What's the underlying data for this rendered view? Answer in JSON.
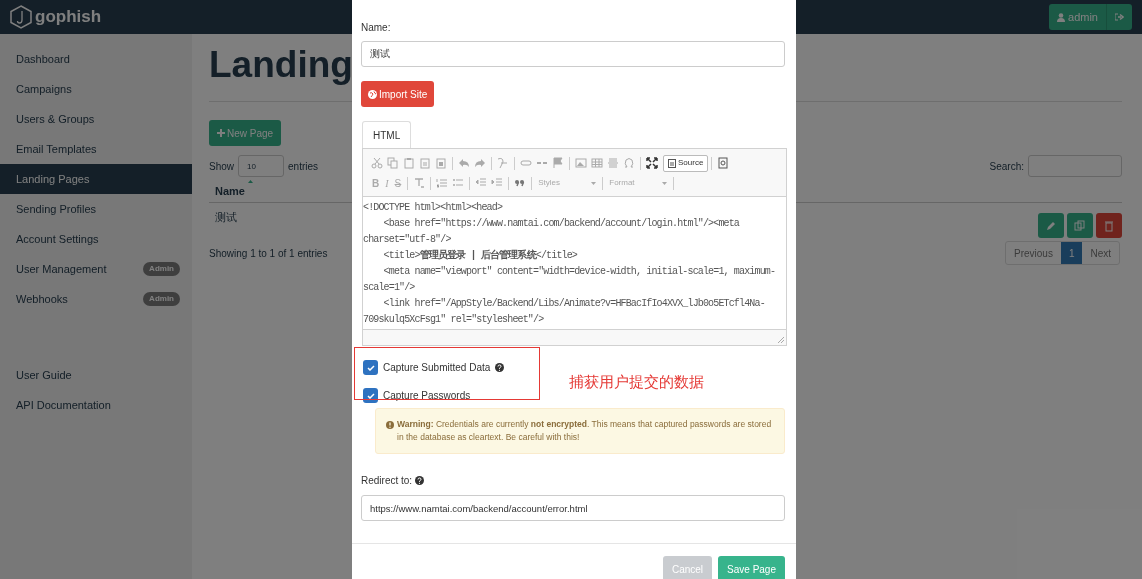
{
  "navbar": {
    "brand": "gophish",
    "user": "admin"
  },
  "sidebar": {
    "items": [
      {
        "label": "Dashboard",
        "selected": false
      },
      {
        "label": "Campaigns",
        "selected": false
      },
      {
        "label": "Users & Groups",
        "selected": false
      },
      {
        "label": "Email Templates",
        "selected": false
      },
      {
        "label": "Landing Pages",
        "selected": true
      },
      {
        "label": "Sending Profiles",
        "selected": false
      },
      {
        "label": "Account Settings",
        "selected": false
      },
      {
        "label": "User Management",
        "selected": false,
        "badge": "Admin"
      },
      {
        "label": "Webhooks",
        "selected": false,
        "badge": "Admin"
      }
    ],
    "links": [
      "User Guide",
      "API Documentation"
    ]
  },
  "page": {
    "title": "Landing",
    "new_button": "New Page",
    "length_before": "Show",
    "length_value": "10",
    "length_after": "entries",
    "search_label": "Search:",
    "columns": [
      "Name"
    ],
    "rows": [
      {
        "name": "测试"
      }
    ],
    "info": "Showing 1 to 1 of 1 entries",
    "pagination": [
      {
        "label": "Previous",
        "selected": false
      },
      {
        "label": "1",
        "selected": true
      },
      {
        "label": "Next",
        "selected": false
      }
    ]
  },
  "modal": {
    "name_label": "Name:",
    "name_value": "测试",
    "import_button": "Import Site",
    "tabs": [
      {
        "label": "HTML",
        "selected": true
      }
    ],
    "toolbar": {
      "source_button": "Source",
      "format_letters": [
        "B",
        "I",
        "S"
      ],
      "dropdowns": [
        "Styles",
        "Format"
      ]
    },
    "code_lines": [
      "<!DOCTYPE html><html><head>",
      "    <base href=\"https://www.namtai.com/backend/account/login.html\"/><meta",
      "charset=\"utf-8\"/>",
      "    <title>**管理员登录 | 后台管理系统**</title>",
      "    <meta name=\"viewport\" content=\"width=device-width, initial-scale=1, maximum-",
      "scale=1\"/>",
      "    <link href=\"/AppStyle/Backend/Libs/Animate?v=HFBacIfIo4XVX_lJb0o5ETcfl4Na-",
      "709skulq5XcFsg1\" rel=\"stylesheet\"/>"
    ],
    "options": [
      {
        "label": "Capture Submitted Data",
        "checked": true,
        "help": true
      },
      {
        "label": "Capture Passwords",
        "checked": true,
        "help": false
      }
    ],
    "warning": "**Warning:** Credentials are currently **not encrypted**. This means that captured passwords are stored in the database as cleartext. Be careful with this!",
    "redirect_label": "Redirect to:",
    "redirect_value": "https://www.namtai.com/backend/account/error.html",
    "buttons": [
      {
        "label": "Cancel",
        "kind": "secondary"
      },
      {
        "label": "Save Page",
        "kind": "primary"
      }
    ]
  },
  "annotation": {
    "text": "捕获用户提交的数据"
  }
}
